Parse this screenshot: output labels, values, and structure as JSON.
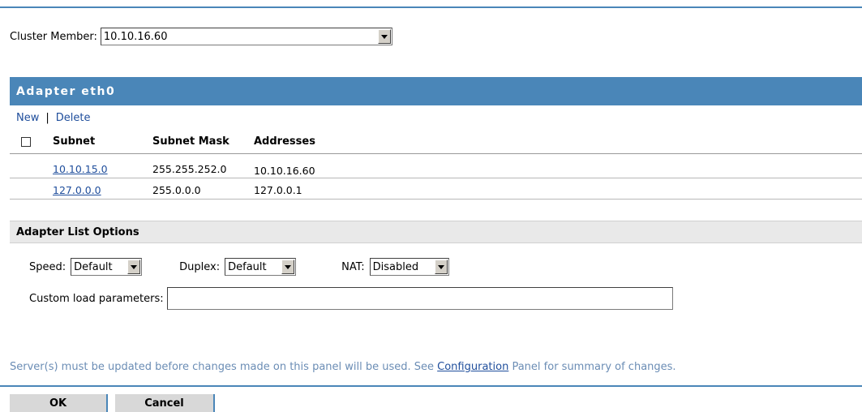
{
  "cluster": {
    "label": "Cluster Member:",
    "value": "10.10.16.60"
  },
  "adapter": {
    "title": "Adapter eth0",
    "actions": {
      "new": "New",
      "separator": "|",
      "delete": "Delete"
    },
    "columns": [
      "Subnet",
      "Subnet Mask",
      "Addresses"
    ],
    "rows": [
      {
        "subnet": "10.10.15.0",
        "mask": "255.255.252.0",
        "addresses": "10.10.16.60"
      },
      {
        "subnet": "127.0.0.0",
        "mask": "255.0.0.0",
        "addresses": "127.0.0.1"
      }
    ]
  },
  "options": {
    "title": "Adapter List Options",
    "speed": {
      "label": "Speed:",
      "value": "Default"
    },
    "duplex": {
      "label": "Duplex:",
      "value": "Default"
    },
    "nat": {
      "label": "NAT:",
      "value": "Disabled"
    },
    "custom": {
      "label": "Custom load parameters:",
      "value": ""
    }
  },
  "footer": {
    "note_before": "Server(s) must be updated before changes made on this panel will be used. See ",
    "note_link": "Configuration",
    "note_after": " Panel for summary of changes."
  },
  "buttons": {
    "ok": "OK",
    "cancel": "Cancel"
  },
  "colors": {
    "accent": "#4a86b8",
    "link": "#1f4e9c",
    "note": "#6b8db5"
  }
}
